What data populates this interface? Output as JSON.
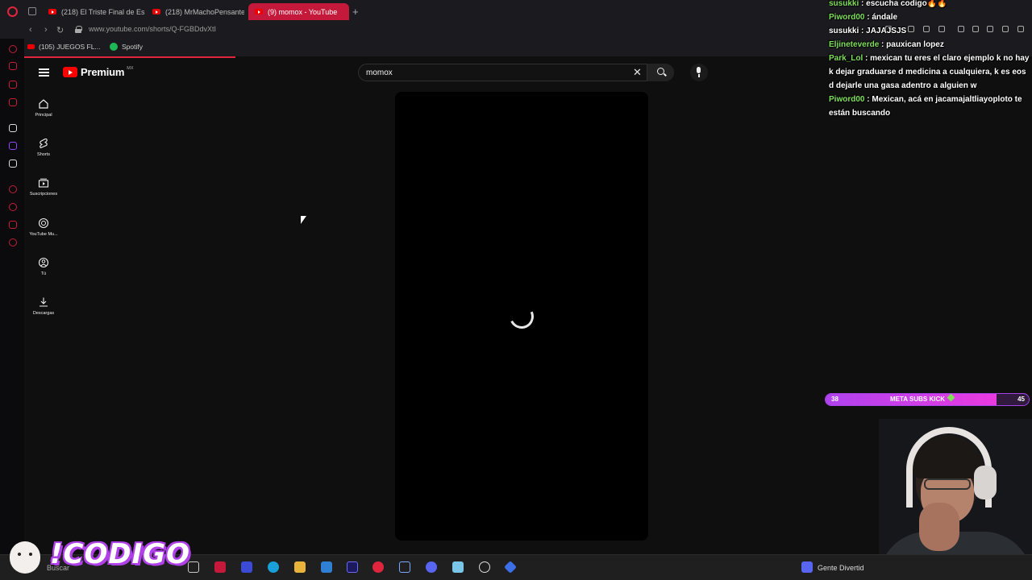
{
  "browser": {
    "tabs": [
      {
        "label": "(218) El Triste Final de Esp",
        "active": false
      },
      {
        "label": "(218) MrMachoPensante",
        "active": false
      },
      {
        "label": "(9) momox - YouTube",
        "active": true
      }
    ],
    "url": "www.youtube.com/shorts/Q-FGBDdvXtI",
    "bookmarks": [
      "(105) JUEGOS FL...",
      "Spotify"
    ],
    "accent_color": "#e0253c"
  },
  "youtube": {
    "logo_text": "Premium",
    "country_code": "MX",
    "search": {
      "value": "momox",
      "placeholder": "Buscar"
    },
    "guide": [
      {
        "label": "Principal",
        "icon": "home-icon"
      },
      {
        "label": "Shorts",
        "icon": "shorts-icon"
      },
      {
        "label": "Suscripciones",
        "icon": "subscriptions-icon"
      },
      {
        "label": "YouTube Mu...",
        "icon": "youtube-music-icon"
      },
      {
        "label": "Tú",
        "icon": "you-icon"
      },
      {
        "label": "Descargas",
        "icon": "downloads-icon"
      }
    ],
    "player_state": "loading"
  },
  "chat": {
    "user_color": "#7ee05a",
    "messages": [
      {
        "user": "susukki",
        "text": "escucha codigo🔥🔥"
      },
      {
        "user": "Piword00",
        "text": "ándale"
      },
      {
        "user": "susukki",
        "text": "JAJAJSJS"
      },
      {
        "user": "Eljineteverde",
        "text": "pauxican lopez"
      },
      {
        "user": "Park_Lol",
        "text": "mexican tu eres el claro ejemplo k no hay k dejar graduarse d medicina a cualquiera, k es eos d dejarle una gasa adentro a alguien w"
      },
      {
        "user": "Piword00",
        "text": "Mexican, acá en jacamajaltliayoploto te están buscando"
      }
    ]
  },
  "meta_subs": {
    "label": "META SUBS KICK",
    "current": "38",
    "goal": "45",
    "progress": 0.84
  },
  "overlay": {
    "brand": "!CODIGO"
  },
  "taskbar": {
    "search_label": "Buscar",
    "right_item": "Gente Divertid"
  }
}
